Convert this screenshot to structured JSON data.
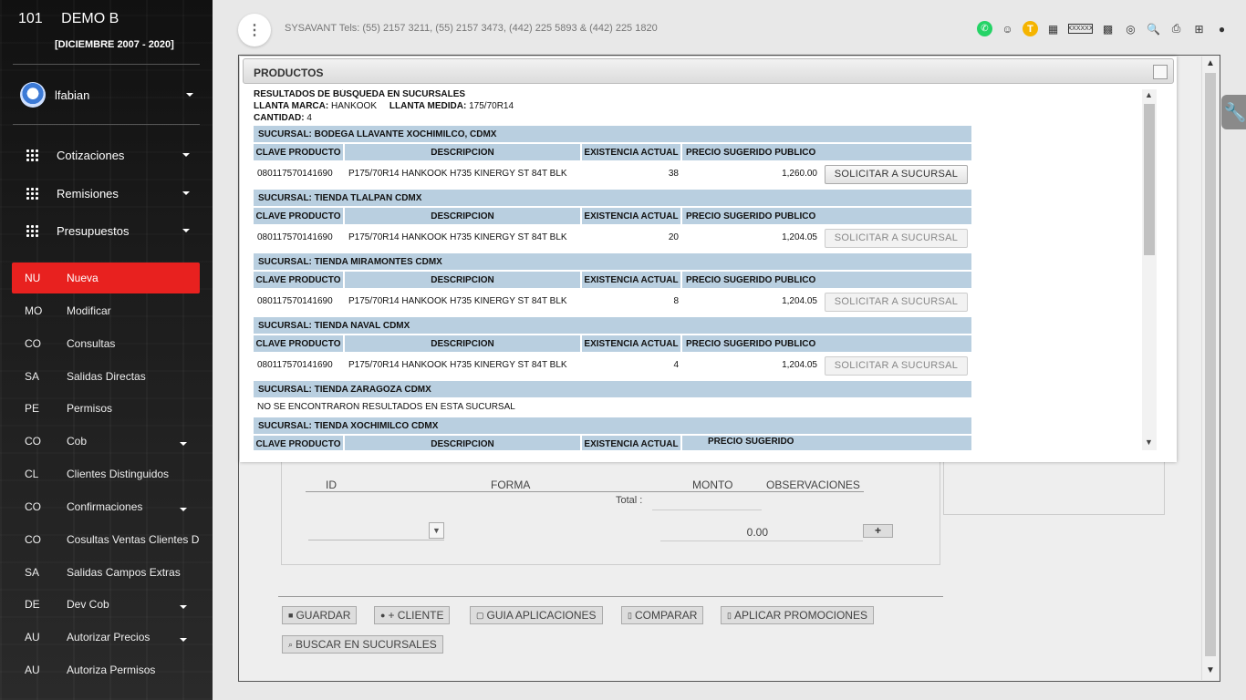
{
  "sidebar": {
    "store_number": "101",
    "store_name": "DEMO B",
    "period": "[DICIEMBRE 2007 - 2020]",
    "username": "lfabian",
    "top_menus": [
      {
        "label": "Cotizaciones"
      },
      {
        "label": "Remisiones"
      },
      {
        "label": "Presupuestos"
      }
    ],
    "items": [
      {
        "abbr": "NU",
        "label": "Nueva",
        "active": true
      },
      {
        "abbr": "MO",
        "label": "Modificar"
      },
      {
        "abbr": "CO",
        "label": "Consultas"
      },
      {
        "abbr": "SA",
        "label": "Salidas Directas"
      },
      {
        "abbr": "PE",
        "label": "Permisos"
      },
      {
        "abbr": "CO",
        "label": "Cob"
      },
      {
        "abbr": "CL",
        "label": "Clientes Distinguidos"
      },
      {
        "abbr": "CO",
        "label": "Confirmaciones"
      },
      {
        "abbr": "CO",
        "label": "Cosultas Ventas Clientes Disti"
      },
      {
        "abbr": "SA",
        "label": "Salidas Campos Extras"
      },
      {
        "abbr": "DE",
        "label": "Dev Cob"
      },
      {
        "abbr": "AU",
        "label": "Autorizar Precios"
      },
      {
        "abbr": "AU",
        "label": "Autoriza Permisos"
      }
    ]
  },
  "header": {
    "phones": "SYSAVANT Tels: (55) 2157 3211, (55) 2157 3473, (442) 225 5893 & (442) 225 1820",
    "t_badge": "T",
    "box_badge": "XXXXXX"
  },
  "modal": {
    "title": "PRODUCTOS",
    "results_title": "RESULTADOS DE BÚSQUEDA EN SUCURSALES",
    "brand_label": "LLANTA MARCA:",
    "brand_value": "HANKOOK",
    "size_label": "LLANTA MEDIDA:",
    "size_value": "175/70R14",
    "qty_label": "CANTIDAD:",
    "qty_value": "4",
    "columns": [
      "CLAVE PRODUCTO",
      "DESCRIPCION",
      "EXISTENCIA ACTUAL",
      "PRECIO SUGERIDO PUBLICO"
    ],
    "request_label": "SOLICITAR A SUCURSAL",
    "no_results": "NO SE ENCONTRARON RESULTADOS EN ESTA SUCURSAL",
    "branches": [
      {
        "name": "SUCURSAL: BODEGA LLAVANTE XOCHIMILCO, CDMX",
        "code": "080117570141690",
        "desc": "P175/70R14 HANKOOK H735 KINERGY ST 84T BLK",
        "stock": "38",
        "price": "1,260.00"
      },
      {
        "name": "SUCURSAL: TIENDA TLALPAN CDMX",
        "code": "080117570141690",
        "desc": "P175/70R14 HANKOOK H735 KINERGY ST 84T BLK",
        "stock": "20",
        "price": "1,204.05"
      },
      {
        "name": "SUCURSAL: TIENDA MIRAMONTES CDMX",
        "code": "080117570141690",
        "desc": "P175/70R14 HANKOOK H735 KINERGY ST 84T BLK",
        "stock": "8",
        "price": "1,204.05"
      },
      {
        "name": "SUCURSAL: TIENDA NAVAL CDMX",
        "code": "080117570141690",
        "desc": "P175/70R14 HANKOOK H735 KINERGY ST 84T BLK",
        "stock": "4",
        "price": "1,204.05"
      },
      {
        "name": "SUCURSAL: TIENDA ZARAGOZA CDMX"
      },
      {
        "name": "SUCURSAL: TIENDA XOCHIMILCO CDMX"
      }
    ],
    "last_columns": [
      "CLAVE PRODUCTO",
      "DESCRIPCION",
      "EXISTENCIA ACTUAL",
      "PRECIO SUGERIDO"
    ]
  },
  "payments": {
    "col_id": "ID",
    "col_forma": "FORMA",
    "col_monto": "MONTO",
    "col_obs": "OBSERVACIONES",
    "total_label": "Total :",
    "amount": "0.00",
    "add": "+"
  },
  "actions": {
    "guardar": "GUARDAR",
    "cliente": "+ CLIENTE",
    "guia": "GUIA APLICACIONES",
    "comparar": "COMPARAR",
    "promociones": "APLICAR PROMOCIONES",
    "buscar": "BUSCAR EN SUCURSALES"
  },
  "colors": {
    "active": "#e8211f",
    "table_header": "#b9cfe0"
  }
}
